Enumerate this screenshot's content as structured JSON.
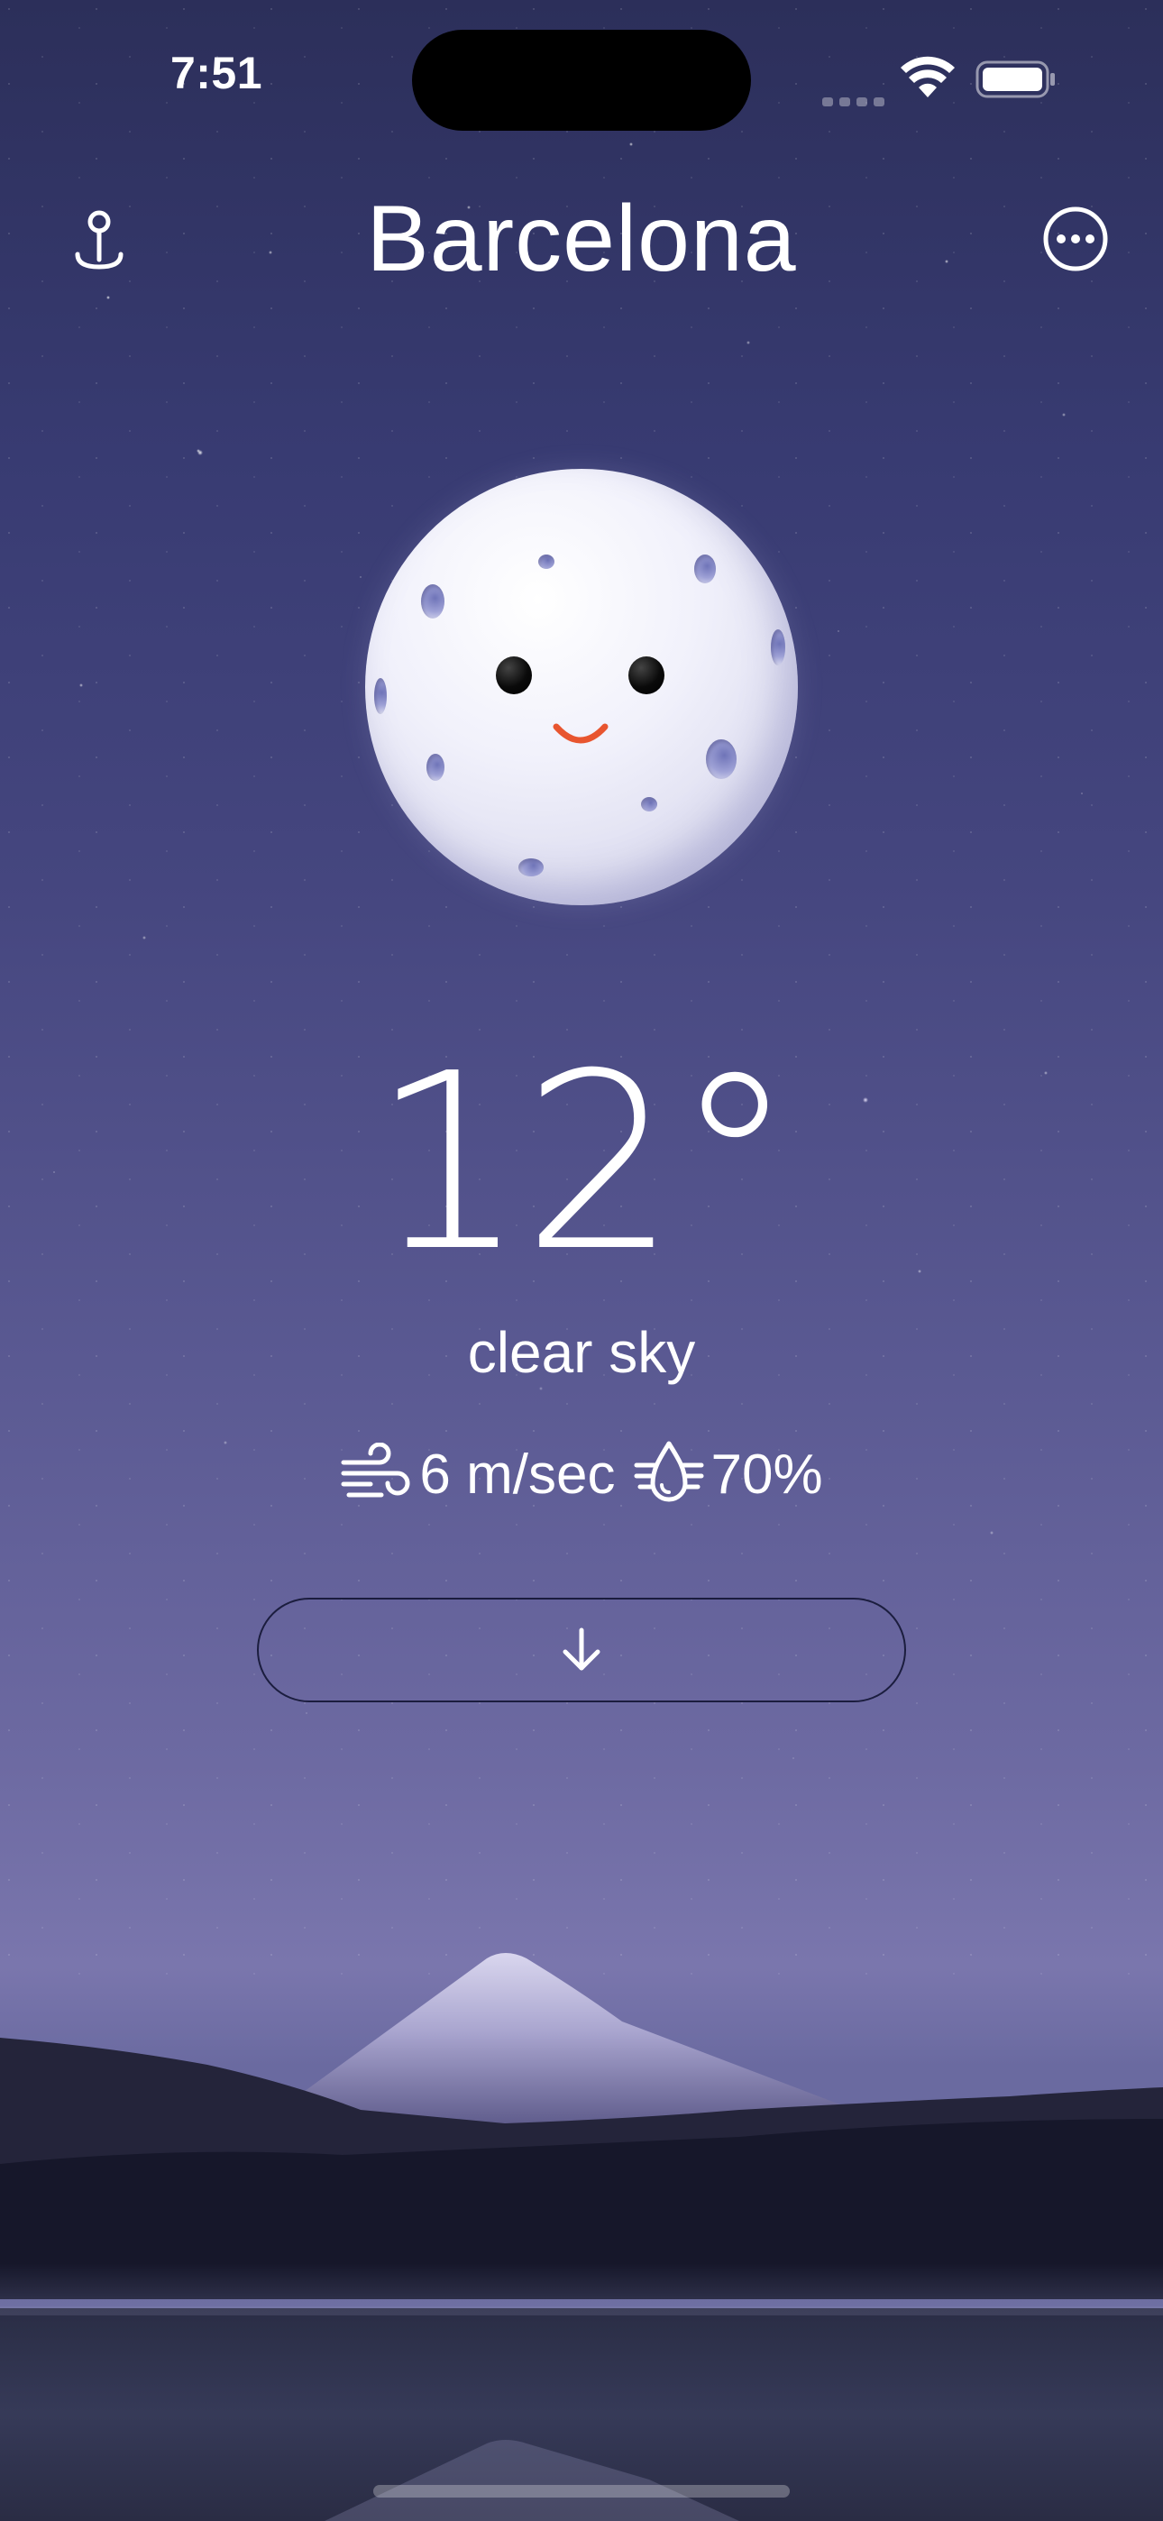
{
  "status_bar": {
    "time": "7:51",
    "icons": [
      "cell-signal-icon",
      "wifi-icon",
      "battery-icon"
    ]
  },
  "header": {
    "city": "Barcelona",
    "left_icon": "location-pin-icon",
    "right_icon": "more-options-icon"
  },
  "weather": {
    "illustration": "moon-face-icon",
    "temperature": "12",
    "degree_symbol": "°",
    "condition": "clear sky",
    "wind": {
      "icon": "wind-icon",
      "value": "6 m/sec"
    },
    "humidity": {
      "icon": "humidity-icon",
      "value": "70%"
    }
  },
  "expand_button": {
    "icon": "arrow-down-icon"
  },
  "background": {
    "sky_top": "#2c2f5a",
    "sky_bottom": "#7a76ad",
    "mountain_snow": "#c9c6e2",
    "forest": "#1c1d30",
    "lake": "#2b3047"
  }
}
